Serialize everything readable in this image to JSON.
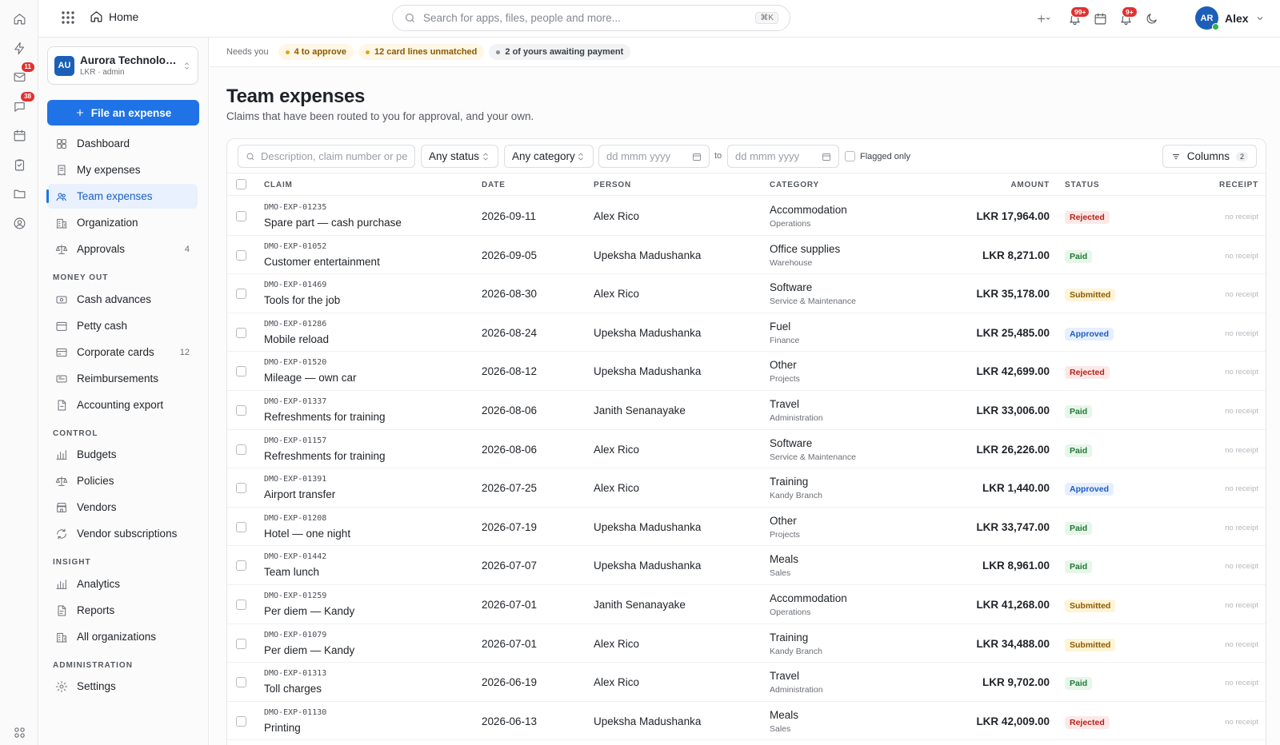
{
  "topbar": {
    "home_label": "Home",
    "search_placeholder": "Search for apps, files, people and more...",
    "search_shortcut": "⌘K",
    "notif_badge_1": "99+",
    "notif_badge_2": "9+",
    "user_initials": "AR",
    "user_name": "Alex"
  },
  "rail": {
    "mail_badge": "11",
    "chat_badge": "38"
  },
  "org": {
    "logo": "AU",
    "name": "Aurora Technologies",
    "sub": "LKR · admin"
  },
  "sidebar": {
    "file_button": "File an expense",
    "main_items": [
      {
        "label": "Dashboard",
        "icon": "grid-icon"
      },
      {
        "label": "My expenses",
        "icon": "receipt-icon"
      },
      {
        "label": "Team expenses",
        "icon": "team-icon"
      },
      {
        "label": "Organization",
        "icon": "building-icon"
      },
      {
        "label": "Approvals",
        "icon": "scale-icon",
        "count": "4"
      }
    ],
    "money_out_title": "MONEY OUT",
    "money_out": [
      {
        "label": "Cash advances",
        "icon": "cash-icon"
      },
      {
        "label": "Petty cash",
        "icon": "wallet-icon"
      },
      {
        "label": "Corporate cards",
        "icon": "card-icon",
        "count": "12"
      },
      {
        "label": "Reimbursements",
        "icon": "refund-icon"
      },
      {
        "label": "Accounting export",
        "icon": "export-icon"
      }
    ],
    "control_title": "CONTROL",
    "control": [
      {
        "label": "Budgets",
        "icon": "bar-chart-icon"
      },
      {
        "label": "Policies",
        "icon": "scale-icon"
      },
      {
        "label": "Vendors",
        "icon": "store-icon"
      },
      {
        "label": "Vendor subscriptions",
        "icon": "refresh-icon"
      }
    ],
    "insight_title": "INSIGHT",
    "insight": [
      {
        "label": "Analytics",
        "icon": "bar-chart-icon"
      },
      {
        "label": "Reports",
        "icon": "report-icon"
      },
      {
        "label": "All organizations",
        "icon": "building-icon"
      }
    ],
    "admin_title": "ADMINISTRATION",
    "admin": [
      {
        "label": "Settings",
        "icon": "gear-icon"
      }
    ]
  },
  "needs": {
    "label": "Needs you",
    "chips": [
      "4 to approve",
      "12 card lines unmatched",
      "2 of yours awaiting payment"
    ]
  },
  "page": {
    "title": "Team expenses",
    "subtitle": "Claims that have been routed to you for approval, and your own."
  },
  "filters": {
    "search_placeholder": "Description, claim number or person",
    "status": "Any status",
    "category": "Any category",
    "date_placeholder": "dd mmm yyyy",
    "to_label": "to",
    "flagged_label": "Flagged only",
    "columns_label": "Columns",
    "columns_count": "2"
  },
  "table": {
    "headers": {
      "claim": "CLAIM",
      "date": "DATE",
      "person": "PERSON",
      "category": "CATEGORY",
      "amount": "AMOUNT",
      "status": "STATUS",
      "receipt": "RECEIPT"
    },
    "rows": [
      {
        "num": "DMO-EXP-01235",
        "desc": "Spare part — cash purchase",
        "date": "2026-09-11",
        "person": "Alex Rico",
        "category": "Accommodation",
        "dept": "Operations",
        "amount": "LKR 17,964.00",
        "status": "Rejected",
        "status_kind": "rejected",
        "receipt": "no receipt"
      },
      {
        "num": "DMO-EXP-01052",
        "desc": "Customer entertainment",
        "date": "2026-09-05",
        "person": "Upeksha Madushanka",
        "category": "Office supplies",
        "dept": "Warehouse",
        "amount": "LKR 8,271.00",
        "status": "Paid",
        "status_kind": "paid",
        "receipt": "no receipt"
      },
      {
        "num": "DMO-EXP-01469",
        "desc": "Tools for the job",
        "date": "2026-08-30",
        "person": "Alex Rico",
        "category": "Software",
        "dept": "Service & Maintenance",
        "amount": "LKR 35,178.00",
        "status": "Submitted",
        "status_kind": "submitted",
        "receipt": "no receipt"
      },
      {
        "num": "DMO-EXP-01286",
        "desc": "Mobile reload",
        "date": "2026-08-24",
        "person": "Upeksha Madushanka",
        "category": "Fuel",
        "dept": "Finance",
        "amount": "LKR 25,485.00",
        "status": "Approved",
        "status_kind": "approved",
        "receipt": "no receipt"
      },
      {
        "num": "DMO-EXP-01520",
        "desc": "Mileage — own car",
        "date": "2026-08-12",
        "person": "Upeksha Madushanka",
        "category": "Other",
        "dept": "Projects",
        "amount": "LKR 42,699.00",
        "status": "Rejected",
        "status_kind": "rejected",
        "receipt": "no receipt"
      },
      {
        "num": "DMO-EXP-01337",
        "desc": "Refreshments for training",
        "date": "2026-08-06",
        "person": "Janith Senanayake",
        "category": "Travel",
        "dept": "Administration",
        "amount": "LKR 33,006.00",
        "status": "Paid",
        "status_kind": "paid",
        "receipt": "no receipt"
      },
      {
        "num": "DMO-EXP-01157",
        "desc": "Refreshments for training",
        "date": "2026-08-06",
        "person": "Alex Rico",
        "category": "Software",
        "dept": "Service & Maintenance",
        "amount": "LKR 26,226.00",
        "status": "Paid",
        "status_kind": "paid",
        "receipt": "no receipt"
      },
      {
        "num": "DMO-EXP-01391",
        "desc": "Airport transfer",
        "date": "2026-07-25",
        "person": "Alex Rico",
        "category": "Training",
        "dept": "Kandy Branch",
        "amount": "LKR 1,440.00",
        "status": "Approved",
        "status_kind": "approved",
        "receipt": "no receipt"
      },
      {
        "num": "DMO-EXP-01208",
        "desc": "Hotel — one night",
        "date": "2026-07-19",
        "person": "Upeksha Madushanka",
        "category": "Other",
        "dept": "Projects",
        "amount": "LKR 33,747.00",
        "status": "Paid",
        "status_kind": "paid",
        "receipt": "no receipt"
      },
      {
        "num": "DMO-EXP-01442",
        "desc": "Team lunch",
        "date": "2026-07-07",
        "person": "Upeksha Madushanka",
        "category": "Meals",
        "dept": "Sales",
        "amount": "LKR 8,961.00",
        "status": "Paid",
        "status_kind": "paid",
        "receipt": "no receipt"
      },
      {
        "num": "DMO-EXP-01259",
        "desc": "Per diem — Kandy",
        "date": "2026-07-01",
        "person": "Janith Senanayake",
        "category": "Accommodation",
        "dept": "Operations",
        "amount": "LKR 41,268.00",
        "status": "Submitted",
        "status_kind": "submitted",
        "receipt": "no receipt"
      },
      {
        "num": "DMO-EXP-01079",
        "desc": "Per diem — Kandy",
        "date": "2026-07-01",
        "person": "Alex Rico",
        "category": "Training",
        "dept": "Kandy Branch",
        "amount": "LKR 34,488.00",
        "status": "Submitted",
        "status_kind": "submitted",
        "receipt": "no receipt"
      },
      {
        "num": "DMO-EXP-01313",
        "desc": "Toll charges",
        "date": "2026-06-19",
        "person": "Alex Rico",
        "category": "Travel",
        "dept": "Administration",
        "amount": "LKR 9,702.00",
        "status": "Paid",
        "status_kind": "paid",
        "receipt": "no receipt"
      },
      {
        "num": "DMO-EXP-01130",
        "desc": "Printing",
        "date": "2026-06-13",
        "person": "Upeksha Madushanka",
        "category": "Meals",
        "dept": "Sales",
        "amount": "LKR 42,009.00",
        "status": "Rejected",
        "status_kind": "rejected",
        "receipt": "no receipt"
      }
    ]
  }
}
